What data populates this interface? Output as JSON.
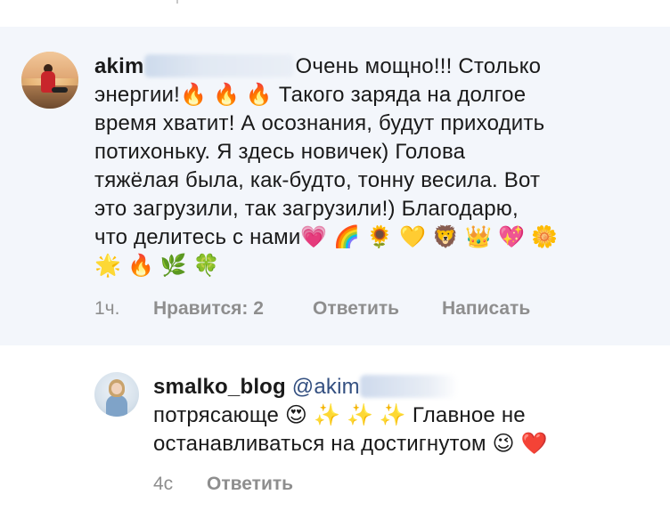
{
  "comments": [
    {
      "username": "akim",
      "username_hidden": "ovanatalja",
      "text_lines": [
        "Очень мощно!!! Столько",
        "энергии!🔥 🔥 🔥 Такого заряда на долгое",
        "время хватит! А осознания, будут приходить",
        "потихоньку. Я здесь новичек) Голова",
        "тяжёлая была, как-будто, тонну весила. Вот",
        "это загрузили, так загрузили!) Благодарю,",
        "что делитесь с нами💗 🌈 🌻 💛 🦁 👑 💖 🌼",
        "🌟 🔥 🌿 🍀"
      ],
      "time": "1ч.",
      "likes": "Нравится: 2",
      "reply": "Ответить",
      "message": "Написать",
      "highlighted": true
    },
    {
      "username": "smalko_blog",
      "mention": "@akim",
      "text_lines": [
        "потрясающе 😍 ✨ ✨ ✨ Главное не",
        "останавливаться на достигнутом 😉 ❤️"
      ],
      "time": "4с",
      "reply": "Ответить",
      "highlighted": false
    }
  ],
  "colors": {
    "highlight_bg": "#f3f6fb",
    "meta_text": "#8e8e8e",
    "mention": "#334f80"
  }
}
